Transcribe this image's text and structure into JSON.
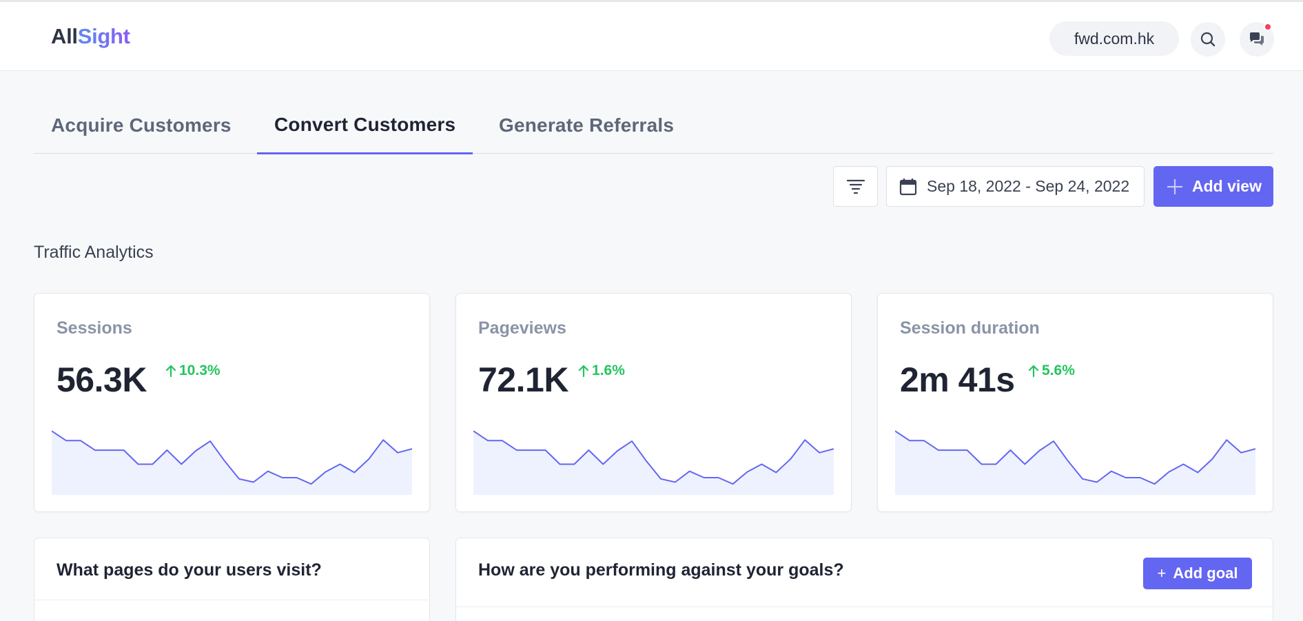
{
  "header": {
    "logo_part1": "All",
    "logo_part2": "Sight",
    "domain": "fwd.com.hk"
  },
  "tabs": [
    {
      "label": "Acquire Customers",
      "active": false
    },
    {
      "label": "Convert Customers",
      "active": true
    },
    {
      "label": "Generate Referrals",
      "active": false
    }
  ],
  "toolbar": {
    "date_range": "Sep 18, 2022 - Sep 24, 2022",
    "add_view_label": "Add view"
  },
  "section": {
    "title": "Traffic Analytics"
  },
  "metrics": [
    {
      "label": "Sessions",
      "value": "56.3K",
      "delta": "10.3%"
    },
    {
      "label": "Pageviews",
      "value": "72.1K",
      "delta": "1.6%"
    },
    {
      "label": "Session duration",
      "value": "2m 41s",
      "delta": "5.6%"
    }
  ],
  "sparkline": {
    "values": [
      100,
      85,
      85,
      70,
      70,
      70,
      48,
      48,
      70,
      48,
      69,
      84,
      53,
      25,
      20,
      37,
      27,
      27,
      17,
      36,
      48,
      35,
      56,
      86,
      66,
      72
    ],
    "max": 110,
    "line_color": "#6366f1",
    "fill_color": "#eef2ff"
  },
  "panels": {
    "pages_title": "What pages do your users visit?",
    "goals_title": "How are you performing against your goals?",
    "add_goal_label": "Add goal"
  },
  "colors": {
    "accent": "#6366f1",
    "positive": "#22c55e",
    "notification": "#f43f5e"
  }
}
